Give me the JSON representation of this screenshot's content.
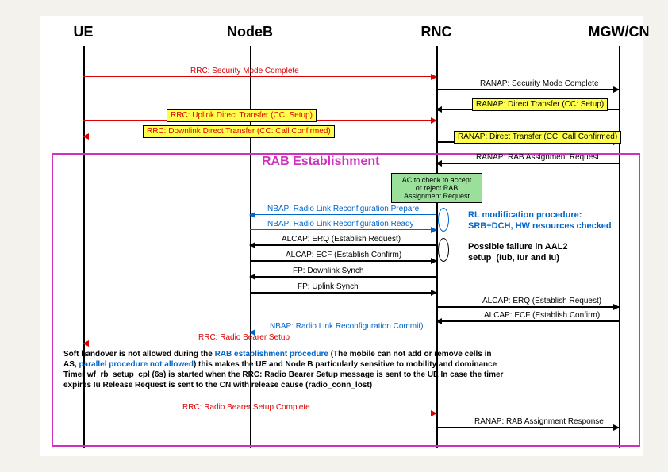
{
  "actors": {
    "ue": "UE",
    "nodeb": "NodeB",
    "rnc": "RNC",
    "mgwcn": "MGW/CN"
  },
  "positions": {
    "ue": 55,
    "nodeb": 265,
    "rnc": 500,
    "mgwcn": 730
  },
  "rab_title": "RAB Establishment",
  "ac_box": "AC to check to accept\nor reject RAB\nAssignment Request",
  "notes": {
    "rl_mod": "RL modification procedure:\nSRB+DCH, HW resources checked",
    "aal2_fail": "Possible failure in AAL2\nsetup  (Iub, Iur and Iu)"
  },
  "paragraph": {
    "p1a": "Soft handover is not allowed during the ",
    "p1b": "RAB establishment procedure",
    "p1c": " (The mobile can not add or remove cells in",
    "p2a": "AS, ",
    "p2b": "parallel procedure not allowed",
    "p2c": ") this makes the UE and Node B particularly sensitive to mobility and dominance",
    "p3": "Timer wf_rb_setup_cpl (6s) is started when the RRC: Radio Bearer Setup message is sent to the UE In case the timer",
    "p4": "expires Iu Release Request is sent to the CN with release cause (radio_conn_lost)"
  },
  "messages": {
    "m1": "RRC: Security Mode Complete",
    "m2": "RANAP: Security Mode Complete",
    "m3": "RANAP: Direct Transfer (CC: Setup)",
    "m4": "RRC: Uplink Direct Transfer (CC: Setup)",
    "m5": "RRC: Downlink Direct Transfer (CC: Call Confirmed)",
    "m6": "RANAP: Direct Transfer (CC: Call Confirmed)",
    "m7": "RANAP: RAB Assignment Request",
    "m8": "NBAP: Radio Link Reconfiguration Prepare",
    "m9": "NBAP: Radio Link Reconfiguration Ready",
    "m10": "ALCAP: ERQ (Establish Request)",
    "m11": "ALCAP: ECF (Establish Confirm)",
    "m12": "FP:  Downlink Synch",
    "m13": "FP:  Uplink Synch",
    "m14": "ALCAP: ERQ (Establish Request)",
    "m15": "ALCAP: ECF (Establish Confirm)",
    "m16": "NBAP: Radio Link Reconfiguration Commit)",
    "m17": "RRC: Radio Bearer Setup",
    "m18": "RRC: Radio Bearer Setup Complete",
    "m19": "RANAP: RAB Assignment Response"
  }
}
